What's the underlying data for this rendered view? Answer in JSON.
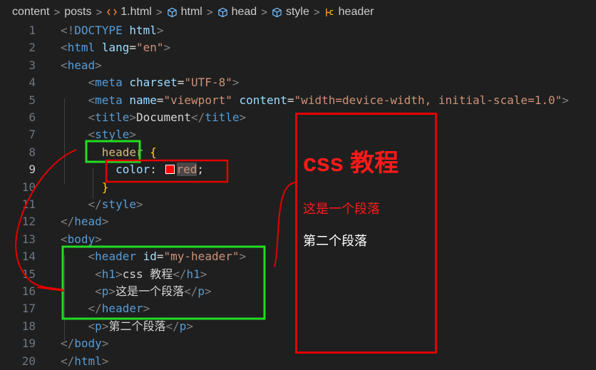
{
  "breadcrumb": {
    "items": [
      {
        "label": "content",
        "icon": ""
      },
      {
        "label": "posts",
        "icon": ""
      },
      {
        "label": "1.html",
        "icon": "html-file-icon"
      },
      {
        "label": "html",
        "icon": "element-cube-icon"
      },
      {
        "label": "head",
        "icon": "element-cube-icon"
      },
      {
        "label": "style",
        "icon": "element-cube-icon"
      },
      {
        "label": "header",
        "icon": "css-selector-icon"
      }
    ],
    "separator": ">"
  },
  "editor": {
    "active_line": 9,
    "line_numbers": [
      "1",
      "2",
      "3",
      "4",
      "5",
      "6",
      "7",
      "8",
      "9",
      "10",
      "11",
      "12",
      "13",
      "14",
      "15",
      "16",
      "17",
      "18",
      "19",
      "20"
    ],
    "lines": [
      {
        "n": "1",
        "tokens": [
          {
            "t": "<!",
            "c": "tag"
          },
          {
            "t": "DOCTYPE",
            "c": "tn"
          },
          {
            "t": " html",
            "c": "attr"
          },
          {
            "t": ">",
            "c": "tag"
          }
        ]
      },
      {
        "n": "2",
        "tokens": [
          {
            "t": "<",
            "c": "tag"
          },
          {
            "t": "html",
            "c": "tn"
          },
          {
            "t": " lang",
            "c": "attr"
          },
          {
            "t": "=",
            "c": "txt"
          },
          {
            "t": "\"en\"",
            "c": "str"
          },
          {
            "t": ">",
            "c": "tag"
          }
        ]
      },
      {
        "n": "3",
        "tokens": [
          {
            "t": "<",
            "c": "tag"
          },
          {
            "t": "head",
            "c": "tn"
          },
          {
            "t": ">",
            "c": "tag"
          }
        ]
      },
      {
        "n": "4",
        "tokens": [
          {
            "t": "    <",
            "c": "tag"
          },
          {
            "t": "meta",
            "c": "tn"
          },
          {
            "t": " charset",
            "c": "attr"
          },
          {
            "t": "=",
            "c": "txt"
          },
          {
            "t": "\"UTF-8\"",
            "c": "str"
          },
          {
            "t": ">",
            "c": "tag"
          }
        ]
      },
      {
        "n": "5",
        "tokens": [
          {
            "t": "    <",
            "c": "tag"
          },
          {
            "t": "meta",
            "c": "tn"
          },
          {
            "t": " name",
            "c": "attr"
          },
          {
            "t": "=",
            "c": "txt"
          },
          {
            "t": "\"viewport\"",
            "c": "str"
          },
          {
            "t": " content",
            "c": "attr"
          },
          {
            "t": "=",
            "c": "txt"
          },
          {
            "t": "\"width=device-width, initial-scale=1.0\"",
            "c": "str"
          },
          {
            "t": ">",
            "c": "tag"
          }
        ]
      },
      {
        "n": "6",
        "tokens": [
          {
            "t": "    <",
            "c": "tag"
          },
          {
            "t": "title",
            "c": "tn"
          },
          {
            "t": ">",
            "c": "tag"
          },
          {
            "t": "Document",
            "c": "txt"
          },
          {
            "t": "</",
            "c": "tag"
          },
          {
            "t": "title",
            "c": "tn"
          },
          {
            "t": ">",
            "c": "tag"
          }
        ]
      },
      {
        "n": "7",
        "tokens": [
          {
            "t": "    <",
            "c": "tag"
          },
          {
            "t": "style",
            "c": "tn"
          },
          {
            "t": ">",
            "c": "tag"
          }
        ]
      },
      {
        "n": "8",
        "tokens": [
          {
            "t": "      header",
            "c": "sel"
          },
          {
            "t": " {",
            "c": "brace"
          }
        ]
      },
      {
        "n": "9",
        "tokens": [
          {
            "t": "        color",
            "c": "prop"
          },
          {
            "t": ": ",
            "c": "txt"
          },
          {
            "t": "SWATCH",
            "c": "swatch"
          },
          {
            "t": "red",
            "c": "val"
          },
          {
            "t": ";",
            "c": "txt"
          }
        ]
      },
      {
        "n": "10",
        "tokens": [
          {
            "t": "      }",
            "c": "brace"
          }
        ]
      },
      {
        "n": "11",
        "tokens": [
          {
            "t": "    </",
            "c": "tag"
          },
          {
            "t": "style",
            "c": "tn"
          },
          {
            "t": ">",
            "c": "tag"
          }
        ]
      },
      {
        "n": "12",
        "tokens": [
          {
            "t": "</",
            "c": "tag"
          },
          {
            "t": "head",
            "c": "tn"
          },
          {
            "t": ">",
            "c": "tag"
          }
        ]
      },
      {
        "n": "13",
        "tokens": [
          {
            "t": "<",
            "c": "tag"
          },
          {
            "t": "body",
            "c": "tn"
          },
          {
            "t": ">",
            "c": "tag"
          }
        ]
      },
      {
        "n": "14",
        "tokens": [
          {
            "t": "    <",
            "c": "tag"
          },
          {
            "t": "header",
            "c": "tn"
          },
          {
            "t": " id",
            "c": "attr"
          },
          {
            "t": "=",
            "c": "txt"
          },
          {
            "t": "\"my-header\"",
            "c": "str"
          },
          {
            "t": ">",
            "c": "tag"
          }
        ]
      },
      {
        "n": "15",
        "tokens": [
          {
            "t": "     <",
            "c": "tag"
          },
          {
            "t": "h1",
            "c": "tn"
          },
          {
            "t": ">",
            "c": "tag"
          },
          {
            "t": "css 教程",
            "c": "txt"
          },
          {
            "t": "</",
            "c": "tag"
          },
          {
            "t": "h1",
            "c": "tn"
          },
          {
            "t": ">",
            "c": "tag"
          }
        ]
      },
      {
        "n": "16",
        "tokens": [
          {
            "t": "     <",
            "c": "tag"
          },
          {
            "t": "p",
            "c": "tn"
          },
          {
            "t": ">",
            "c": "tag"
          },
          {
            "t": "这是一个段落",
            "c": "txt"
          },
          {
            "t": "</",
            "c": "tag"
          },
          {
            "t": "p",
            "c": "tn"
          },
          {
            "t": ">",
            "c": "tag"
          }
        ]
      },
      {
        "n": "17",
        "tokens": [
          {
            "t": "    </",
            "c": "tag"
          },
          {
            "t": "header",
            "c": "tn"
          },
          {
            "t": ">",
            "c": "tag"
          }
        ]
      },
      {
        "n": "18",
        "tokens": [
          {
            "t": "    <",
            "c": "tag"
          },
          {
            "t": "p",
            "c": "tn"
          },
          {
            "t": ">",
            "c": "tag"
          },
          {
            "t": "第二个段落",
            "c": "txt"
          },
          {
            "t": "</",
            "c": "tag"
          },
          {
            "t": "p",
            "c": "tn"
          },
          {
            "t": ">",
            "c": "tag"
          }
        ]
      },
      {
        "n": "19",
        "tokens": [
          {
            "t": "</",
            "c": "tag"
          },
          {
            "t": "body",
            "c": "tn"
          },
          {
            "t": ">",
            "c": "tag"
          }
        ]
      },
      {
        "n": "20",
        "tokens": [
          {
            "t": "</",
            "c": "tag"
          },
          {
            "t": "html",
            "c": "tn"
          },
          {
            "t": ">",
            "c": "tag"
          }
        ]
      }
    ]
  },
  "preview": {
    "h1": "css 教程",
    "p1": "这是一个段落",
    "p2": "第二个段落"
  },
  "colors": {
    "editor_bg": "#1f1f1f",
    "annotation_red": "#e50000",
    "annotation_green": "#22dd22",
    "header_text_color": "#ff1a1a"
  }
}
